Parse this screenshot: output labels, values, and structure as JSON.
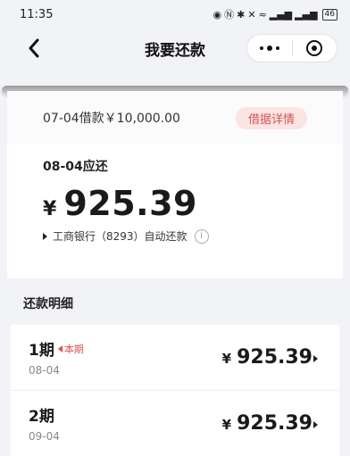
{
  "status_bar": {
    "time": "11:35",
    "battery": "46"
  },
  "nav": {
    "title": "我要还款"
  },
  "loan": {
    "summary": "07-04借款￥10,000.00",
    "detail_button": "借据详情"
  },
  "due": {
    "label": "08-04应还",
    "currency": "¥",
    "amount": "925.39",
    "auto_repay": "工商银行（8293）自动还款"
  },
  "details": {
    "title": "还款明细",
    "rows": [
      {
        "period": "1期",
        "tag": "本期",
        "date": "08-04",
        "currency": "¥",
        "amount": "925.39"
      },
      {
        "period": "2期",
        "tag": "",
        "date": "09-04",
        "currency": "¥",
        "amount": "925.39"
      }
    ]
  },
  "colors": {
    "accent_red": "#d9534f",
    "detail_bg": "#fbe4e4",
    "page_bg": "#f2f3f6"
  }
}
